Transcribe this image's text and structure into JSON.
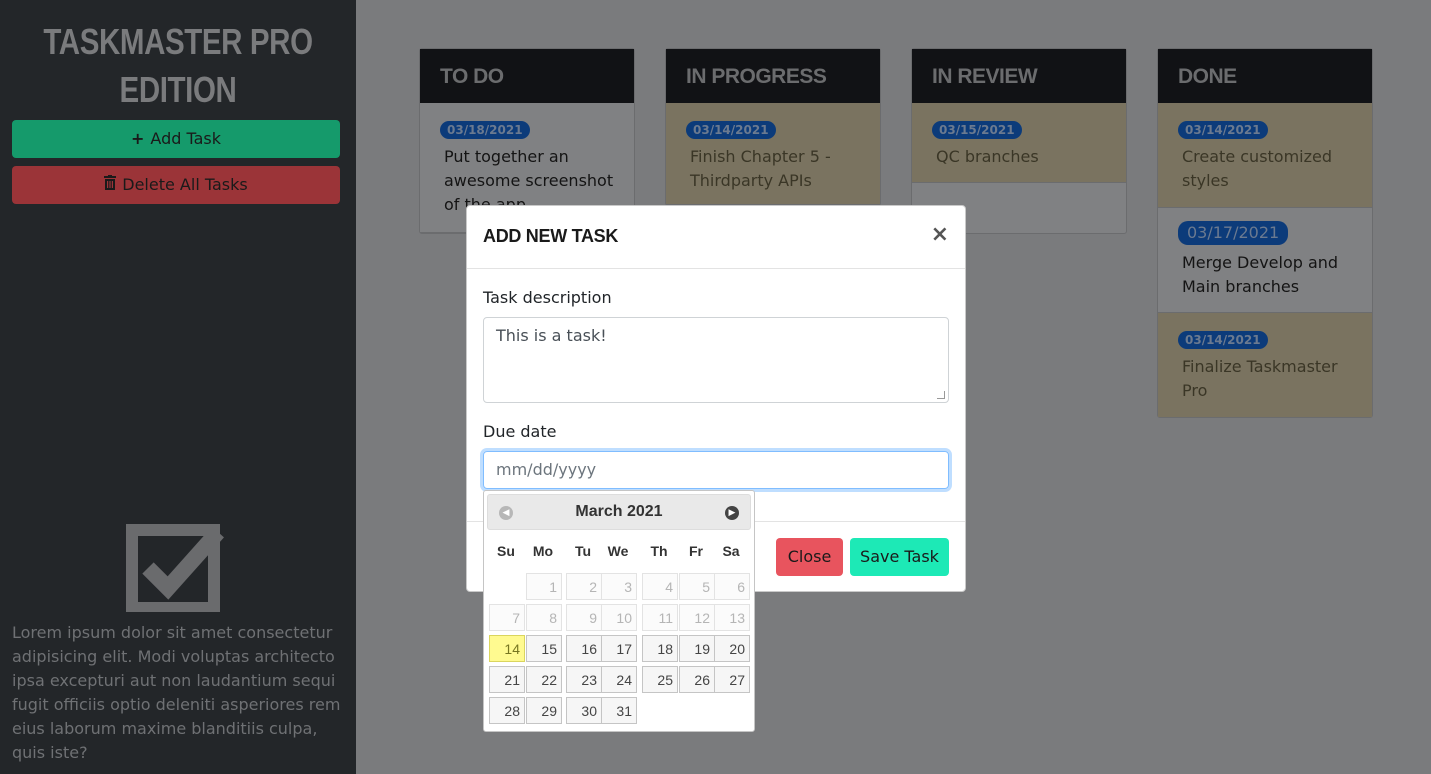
{
  "sidebar": {
    "title": "Taskmaster Pro Edition",
    "add_label": "Add Task",
    "delete_label": "Delete All Tasks",
    "lorem": "Lorem ipsum dolor sit amet consectetur adipisicing elit. Modi voluptas architecto ipsa excepturi aut non laudantium sequi fugit officiis optio deleniti asperiores rem eius laborum maxime blanditiis culpa, quis iste?"
  },
  "columns": [
    {
      "title": "To Do",
      "cards": [
        {
          "date": "03/18/2021",
          "text": "Put together an awesome screenshot of the app",
          "style": "plain"
        }
      ]
    },
    {
      "title": "In Progress",
      "cards": [
        {
          "date": "03/14/2021",
          "text": "Finish Chapter 5 - Thirdparty APIs",
          "style": "hl"
        }
      ]
    },
    {
      "title": "In Review",
      "cards": [
        {
          "date": "03/15/2021",
          "text": "QC branches",
          "style": "hl"
        }
      ]
    },
    {
      "title": "Done",
      "cards": [
        {
          "date": "03/14/2021",
          "text": "Create customized styles",
          "style": "hl"
        },
        {
          "date": "03/17/2021",
          "text": "Merge Develop and Main branches",
          "style": "plain"
        },
        {
          "date": "03/14/2021",
          "text": "Finalize Taskmaster Pro",
          "style": "hl"
        }
      ]
    }
  ],
  "modal": {
    "title": "Add New Task",
    "close_glyph": "×",
    "desc_label": "Task description",
    "desc_value": "This is a task!",
    "due_label": "Due date",
    "due_placeholder": "mm/dd/yyyy",
    "close_label": "Close",
    "save_label": "Save Task"
  },
  "datepicker": {
    "month": "March 2021",
    "dow": [
      "Su",
      "Mo",
      "Tu",
      "We",
      "Th",
      "Fr",
      "Sa"
    ],
    "today": 14,
    "days": [
      1,
      2,
      3,
      4,
      5,
      6,
      7,
      8,
      9,
      10,
      11,
      12,
      13,
      14,
      15,
      16,
      17,
      18,
      19,
      20,
      21,
      22,
      23,
      24,
      25,
      26,
      27,
      28,
      29,
      30,
      31
    ]
  },
  "colors": {
    "accent": "#1de9b6",
    "danger": "#e8545e",
    "today": "#fffa90"
  }
}
